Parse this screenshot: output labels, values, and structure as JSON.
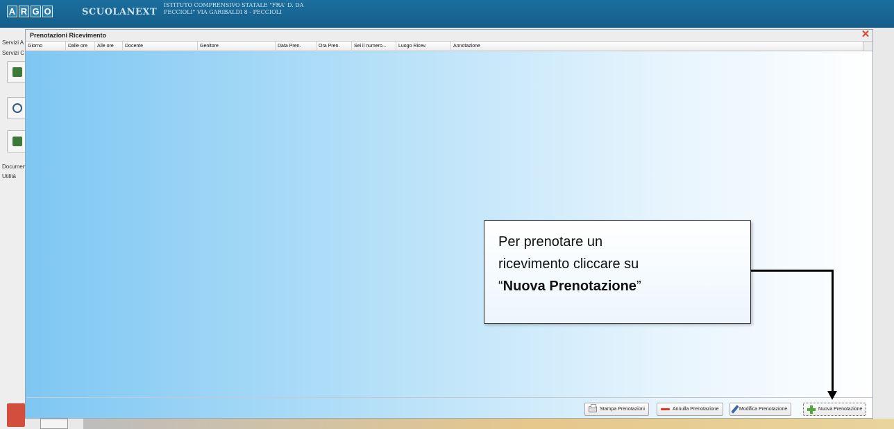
{
  "app": {
    "logo_letters": [
      "A",
      "R",
      "G",
      "O"
    ],
    "name": "SCUOLANEXT",
    "school": "ISTITUTO COMPRENSIVO STATALE \"FRA' D. DA PECCIOLI\" VIA GARIBALDI 8 - PECCIOLI"
  },
  "sidebar": {
    "labels": [
      "Servizi A",
      "Servizi C",
      "Documen",
      "Utilità"
    ]
  },
  "dialog": {
    "title": "Prenotazioni Ricevimento",
    "columns": [
      "Giorno",
      "Dalle ore",
      "Alle ore",
      "Docente",
      "Genitore",
      "Data Pren.",
      "Ora Pren.",
      "Sei il numero...",
      "Luogo Ricev.",
      "Annotazione"
    ],
    "rows": [],
    "buttons": {
      "print": "Stampa Prenotazioni",
      "cancel": "Annulla Prenotazione",
      "edit": "Modifica Prenotazione",
      "new": "Nuova Prenotazione"
    }
  },
  "callout": {
    "line1": "Per prenotare un",
    "line2": "ricevimento cliccare su",
    "quote_open": "“",
    "emphasis": "Nuova Prenotazione",
    "quote_close": "”"
  },
  "icons": {
    "close": "close-icon",
    "print": "printer-icon",
    "cancel": "minus-icon",
    "edit": "pencil-icon",
    "new": "plus-icon"
  },
  "colors": {
    "header_blue": "#1b6f9e",
    "close_red": "#e2432f",
    "plus_green": "#4ea83a",
    "minus_red": "#e0392b"
  }
}
